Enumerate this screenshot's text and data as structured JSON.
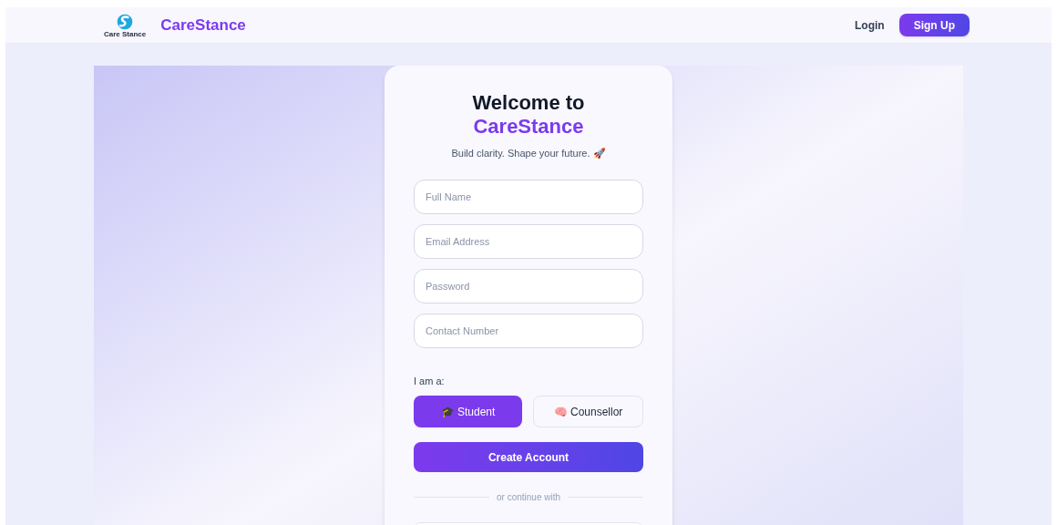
{
  "header": {
    "logo_text": "Care Stance",
    "brand": "CareStance",
    "nav": [
      {
        "label": "Login",
        "kind": "link"
      },
      {
        "label": "Sign Up",
        "kind": "button"
      }
    ]
  },
  "card": {
    "title_line1": "Welcome to",
    "title_line2": "CareStance",
    "subtitle": "Build clarity. Shape your future. 🚀",
    "fields": [
      {
        "placeholder": "Full Name"
      },
      {
        "placeholder": "Email Address"
      },
      {
        "placeholder": "Password"
      },
      {
        "placeholder": "Contact Number"
      }
    ],
    "role_label": "I am a:",
    "roles": [
      {
        "label": "🎓 Student",
        "selected": true
      },
      {
        "label": "🧠 Counsellor",
        "selected": false
      }
    ],
    "submit": "Create Account",
    "divider": "or continue with"
  }
}
